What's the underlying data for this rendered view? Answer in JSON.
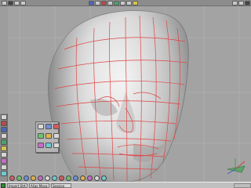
{
  "app": {
    "taskbar_item_1": "Import Strt",
    "taskbar_item_2": "Alias Maya",
    "taskbar_item_3": "Session"
  },
  "viewport": {
    "content": "wireframe face model",
    "wire_color": "#e04545"
  },
  "toolbar": {
    "icons": [
      "select-icon",
      "move-icon",
      "rotate-icon",
      "scale-icon",
      "render-icon",
      "view-icon"
    ]
  }
}
